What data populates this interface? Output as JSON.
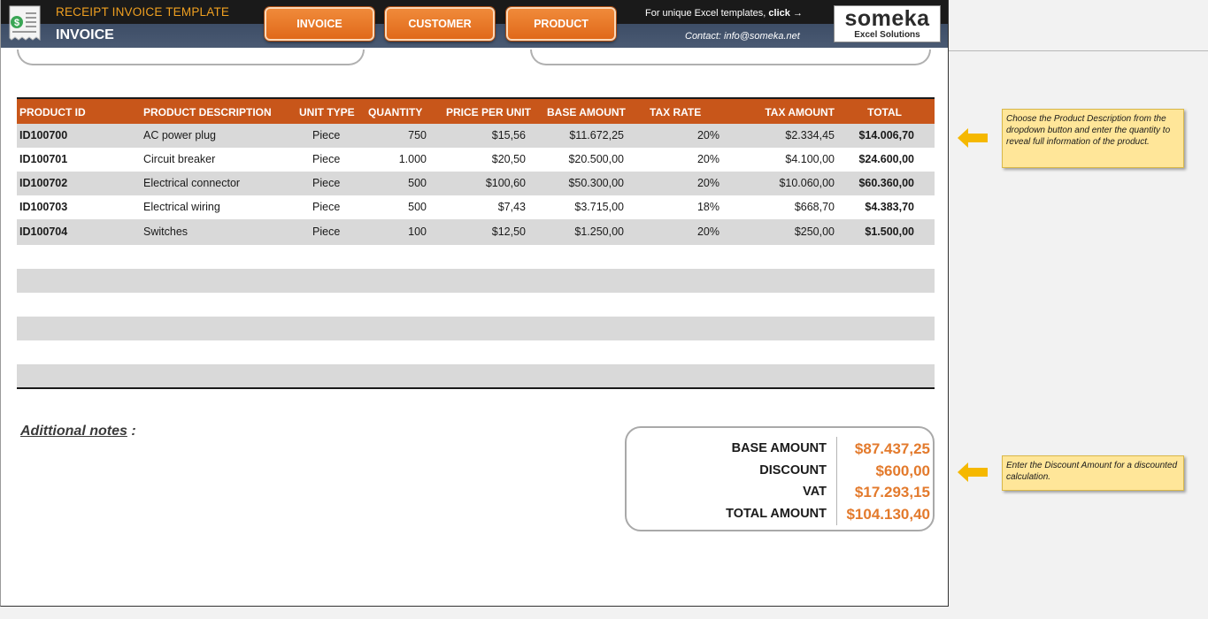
{
  "header": {
    "app_title": "RECEIPT INVOICE TEMPLATE",
    "page_title": "INVOICE",
    "nav": [
      "INVOICE",
      "CUSTOMER",
      "PRODUCT"
    ],
    "promo_text": "For unique Excel templates,",
    "promo_link": "click →",
    "contact": "Contact: info@someka.net",
    "logo_main": "someka",
    "logo_sub": "Excel Solutions"
  },
  "table": {
    "columns": [
      "PRODUCT ID",
      "PRODUCT DESCRIPTION",
      "UNIT TYPE",
      "QUANTITY",
      "PRICE PER UNIT",
      "BASE AMOUNT",
      "TAX RATE",
      "TAX AMOUNT",
      "TOTAL"
    ],
    "rows": [
      [
        "ID100700",
        "AC power plug",
        "Piece",
        "750",
        "$15,56",
        "$11.672,25",
        "20%",
        "$2.334,45",
        "$14.006,70"
      ],
      [
        "ID100701",
        "Circuit breaker",
        "Piece",
        "1.000",
        "$20,50",
        "$20.500,00",
        "20%",
        "$4.100,00",
        "$24.600,00"
      ],
      [
        "ID100702",
        "Electrical connector",
        "Piece",
        "500",
        "$100,60",
        "$50.300,00",
        "20%",
        "$10.060,00",
        "$60.360,00"
      ],
      [
        "ID100703",
        "Electrical wiring",
        "Piece",
        "500",
        "$7,43",
        "$3.715,00",
        "18%",
        "$668,70",
        "$4.383,70"
      ],
      [
        "ID100704",
        "Switches",
        "Piece",
        "100",
        "$12,50",
        "$1.250,00",
        "20%",
        "$250,00",
        "$1.500,00"
      ]
    ]
  },
  "notes_label": "Adittional notes",
  "notes_colon": ":",
  "totals": {
    "base_label": "BASE AMOUNT",
    "base_value": "$87.437,25",
    "discount_label": "DISCOUNT",
    "discount_value": "$600,00",
    "vat_label": "VAT",
    "vat_value": "$17.293,15",
    "total_label": "TOTAL AMOUNT",
    "total_value": "$104.130,40"
  },
  "tips": {
    "product_tip": "Choose the Product Description from the dropdown button and enter the quantity to reveal full information of the product.",
    "discount_tip": "Enter the Discount Amount for a discounted calculation."
  },
  "colors": {
    "accent": "#e0691a",
    "header_row": "#c8561a",
    "total_value": "#e37a2c",
    "tip_bg": "#ffe699",
    "arrow": "#f5b800"
  }
}
